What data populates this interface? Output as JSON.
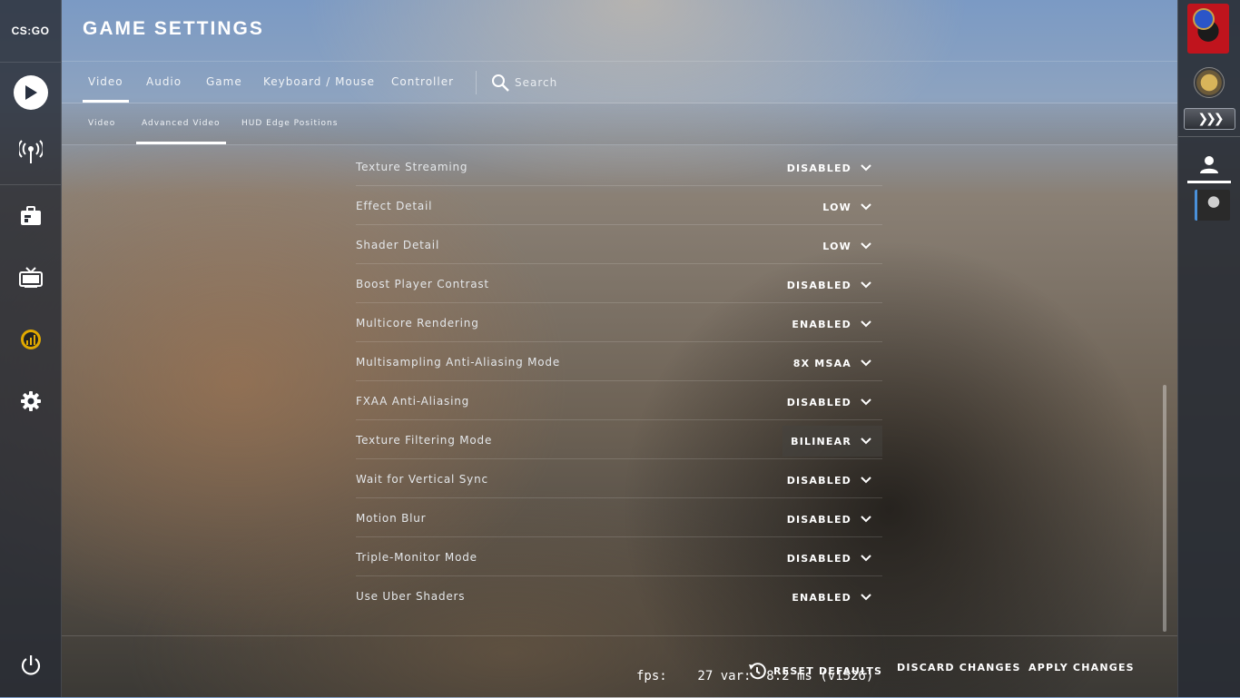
{
  "app": {
    "logo_text": "CS:GO"
  },
  "header": {
    "title": "GAME SETTINGS"
  },
  "tabs": [
    {
      "label": "Video",
      "active": true
    },
    {
      "label": "Audio",
      "active": false
    },
    {
      "label": "Game",
      "active": false
    },
    {
      "label": "Keyboard / Mouse",
      "active": false
    },
    {
      "label": "Controller",
      "active": false
    }
  ],
  "search": {
    "label": "Search"
  },
  "subtabs": [
    {
      "label": "Video",
      "active": false
    },
    {
      "label": "Advanced Video",
      "active": true
    },
    {
      "label": "HUD Edge Positions",
      "active": false
    }
  ],
  "settings": [
    {
      "label": "Texture Streaming",
      "value": "DISABLED"
    },
    {
      "label": "Effect Detail",
      "value": "LOW"
    },
    {
      "label": "Shader Detail",
      "value": "LOW"
    },
    {
      "label": "Boost Player Contrast",
      "value": "DISABLED"
    },
    {
      "label": "Multicore Rendering",
      "value": "ENABLED"
    },
    {
      "label": "Multisampling Anti-Aliasing Mode",
      "value": "8X MSAA"
    },
    {
      "label": "FXAA Anti-Aliasing",
      "value": "DISABLED"
    },
    {
      "label": "Texture Filtering Mode",
      "value": "BILINEAR",
      "highlighted": true
    },
    {
      "label": "Wait for Vertical Sync",
      "value": "DISABLED"
    },
    {
      "label": "Motion Blur",
      "value": "DISABLED"
    },
    {
      "label": "Triple-Monitor Mode",
      "value": "DISABLED"
    },
    {
      "label": "Use Uber Shaders",
      "value": "ENABLED"
    }
  ],
  "footer": {
    "reset": "RESET DEFAULTS",
    "discard": "DISCARD CHANGES",
    "apply": "APPLY CHANGES"
  },
  "overlay": {
    "fps_text": "fps:    27 var:  8.2 ms (v1526)"
  },
  "colors": {
    "accent": "#ffffff",
    "panel": "#282c34"
  },
  "icons": [
    "play-icon",
    "broadcast-icon",
    "inventory-icon",
    "tv-icon",
    "stats-icon",
    "gear-icon",
    "power-icon",
    "search-icon",
    "chevron-down-icon",
    "history-icon",
    "person-icon"
  ]
}
